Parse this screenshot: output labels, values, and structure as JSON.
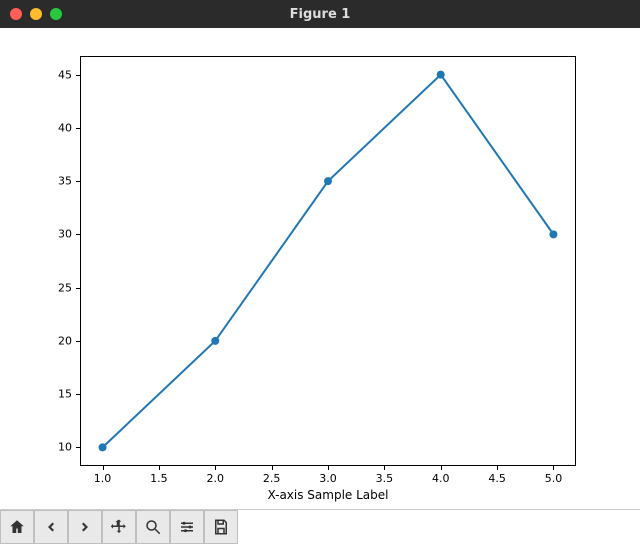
{
  "window": {
    "title": "Figure 1"
  },
  "toolbar": {
    "home": "Home",
    "back": "Back",
    "forward": "Forward",
    "pan": "Pan",
    "zoom": "Zoom",
    "configure": "Configure subplots",
    "save": "Save"
  },
  "chart_data": {
    "type": "line",
    "x": [
      1.0,
      2.0,
      3.0,
      4.0,
      5.0
    ],
    "y": [
      10,
      20,
      35,
      45,
      30
    ],
    "xticks": [
      "1.0",
      "1.5",
      "2.0",
      "2.5",
      "3.0",
      "3.5",
      "4.0",
      "4.5",
      "5.0"
    ],
    "yticks": [
      "10",
      "15",
      "20",
      "25",
      "30",
      "35",
      "40",
      "45"
    ],
    "xlabel": "X-axis Sample Label",
    "ylabel": "",
    "xlim": [
      0.8,
      5.2
    ],
    "ylim": [
      8.25,
      46.75
    ],
    "line_color": "#1f77b4",
    "marker": "o"
  }
}
